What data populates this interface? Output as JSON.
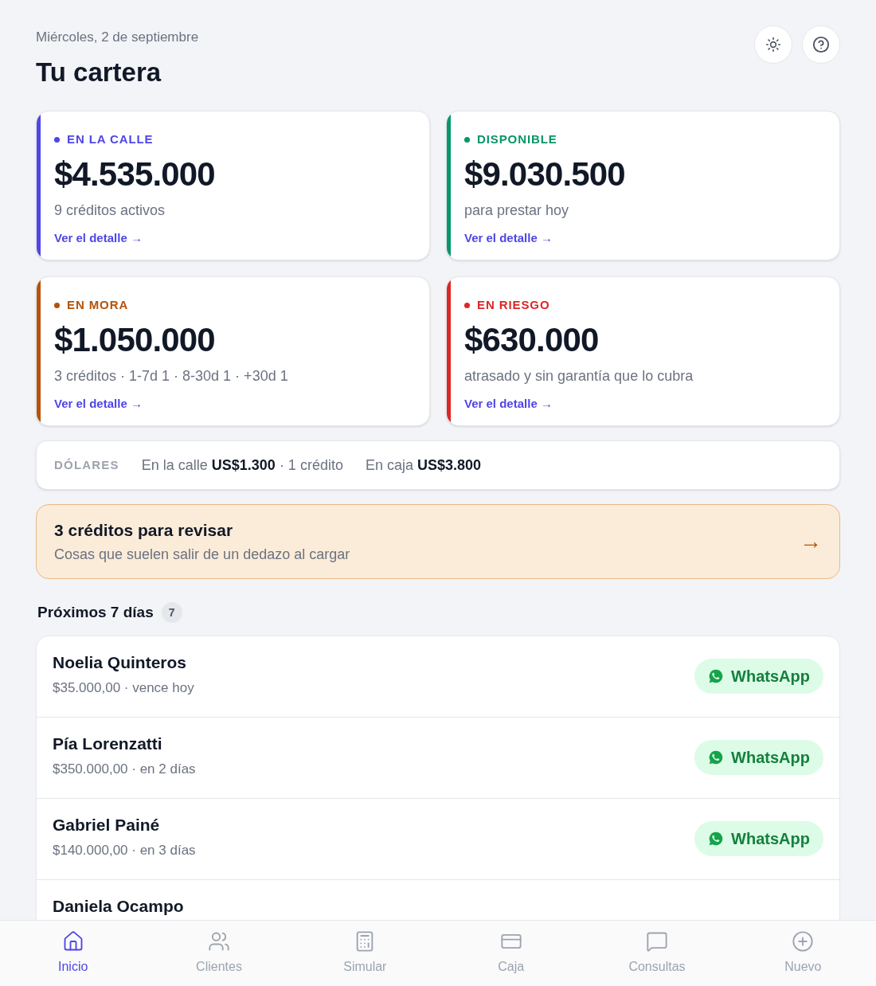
{
  "header": {
    "date": "Miércoles, 2 de septiembre",
    "title": "Tu cartera"
  },
  "cards": [
    {
      "label": "EN LA CALLE",
      "color": "#4f46e5",
      "amount": "$4.535.000",
      "note": "9 créditos activos",
      "link": "Ver el detalle →"
    },
    {
      "label": "DISPONIBLE",
      "color": "#059669",
      "amount": "$9.030.500",
      "note": "para prestar hoy",
      "link": "Ver el detalle →"
    },
    {
      "label": "EN MORA",
      "color": "#b45309",
      "amount": "$1.050.000",
      "note": "3 créditos · 1-7d 1 · 8-30d 1 · +30d 1",
      "link": "Ver el detalle →"
    },
    {
      "label": "EN RIESGO",
      "color": "#dc2626",
      "amount": "$630.000",
      "note": "atrasado y sin garantía que lo cubra",
      "link": "Ver el detalle →"
    }
  ],
  "dollars": {
    "label": "DÓLARES",
    "street": "En la calle **US$1.300** · 1 crédito",
    "cash": "En caja **US$3.800**"
  },
  "review": {
    "title": "3 créditos para revisar",
    "subtitle": "Cosas que suelen salir de un dedazo al cargar",
    "arrow": "→"
  },
  "upcoming": {
    "title": "Próximos 7 días",
    "count": "7",
    "rows": [
      {
        "name": "Noelia Quinteros",
        "detail": "$35.000,00 · vence hoy",
        "action": "WhatsApp"
      },
      {
        "name": "Pía Lorenzatti",
        "detail": "$350.000,00 · en 2 días",
        "action": "WhatsApp"
      },
      {
        "name": "Gabriel Painé",
        "detail": "$140.000,00 · en 3 días",
        "action": "WhatsApp"
      },
      {
        "name": "Daniela Ocampo"
      }
    ]
  },
  "nav": [
    {
      "label": "Inicio",
      "kind": "home",
      "selected": true
    },
    {
      "label": "Clientes",
      "kind": "users",
      "selected": false
    },
    {
      "label": "Simular",
      "kind": "calculator",
      "selected": false
    },
    {
      "label": "Caja",
      "kind": "wallet",
      "selected": false
    },
    {
      "label": "Consultas",
      "kind": "message",
      "selected": false
    },
    {
      "label": "Nuevo",
      "kind": "plus",
      "selected": false
    }
  ]
}
